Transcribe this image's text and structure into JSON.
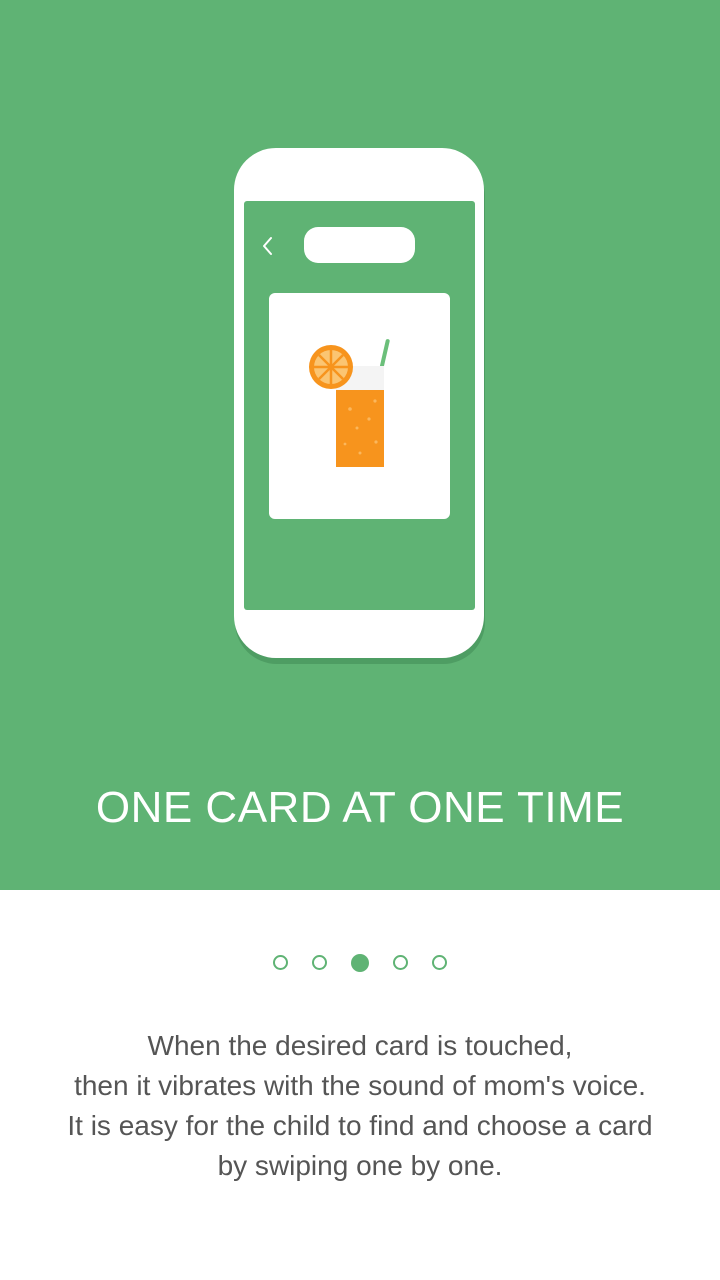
{
  "hero": {
    "title": "ONE CARD AT ONE TIME"
  },
  "pager": {
    "total": 5,
    "active_index": 2
  },
  "description": {
    "lines": [
      "When the desired card is touched,",
      "then it vibrates with the sound of mom's voice.",
      "It is easy for the child to find and choose a card",
      "by swiping one by one."
    ]
  },
  "colors": {
    "brand_green": "#5fb374",
    "illustration_orange": "#f7941d",
    "text_gray": "#555555"
  },
  "icons": {
    "back": "chevron-left-icon",
    "card_image": "orange-juice-icon"
  }
}
